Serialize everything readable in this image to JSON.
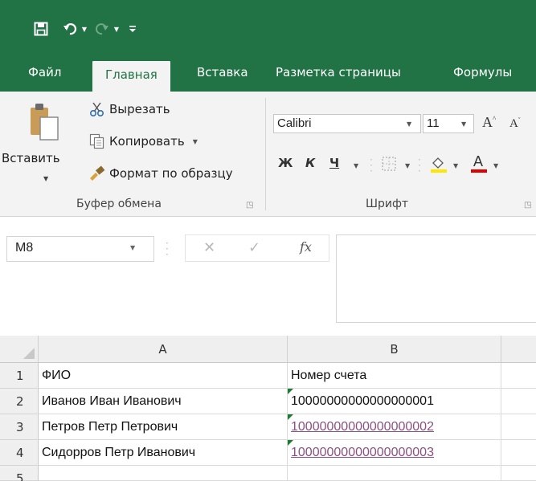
{
  "qat": {
    "save_icon": "save-icon",
    "undo_icon": "undo-icon",
    "redo_icon": "redo-icon"
  },
  "tabs": [
    {
      "label": "Файл"
    },
    {
      "label": "Главная"
    },
    {
      "label": "Вставка"
    },
    {
      "label": "Разметка страницы"
    },
    {
      "label": "Формулы"
    }
  ],
  "clipboard": {
    "paste_label": "Вставить",
    "cut_label": "Вырезать",
    "copy_label": "Копировать",
    "format_painter_label": "Формат по образцу",
    "group_label": "Буфер обмена"
  },
  "font": {
    "font_name": "Calibri",
    "font_size": "11",
    "bold_label": "Ж",
    "italic_label": "К",
    "underline_label": "Ч",
    "group_label": "Шрифт"
  },
  "formula_bar": {
    "name_box": "M8",
    "fx_label": "fx",
    "value": ""
  },
  "sheet": {
    "columns": [
      "A",
      "B"
    ],
    "rows": [
      {
        "num": "1",
        "a": "ФИО",
        "b": "Номер счета"
      },
      {
        "num": "2",
        "a": "Иванов Иван Иванович",
        "b": "10000000000000000001"
      },
      {
        "num": "3",
        "a": "Петров Петр Петрович",
        "b": "10000000000000000002"
      },
      {
        "num": "4",
        "a": "Сидорров Петр Иванович",
        "b": "10000000000000000003"
      },
      {
        "num": "5",
        "a": "",
        "b": ""
      }
    ]
  },
  "colors": {
    "accent": "#217346",
    "ribbon_bg": "#f3f3f3",
    "link": "#8b4f82",
    "error_triangle": "#1e7a35"
  }
}
